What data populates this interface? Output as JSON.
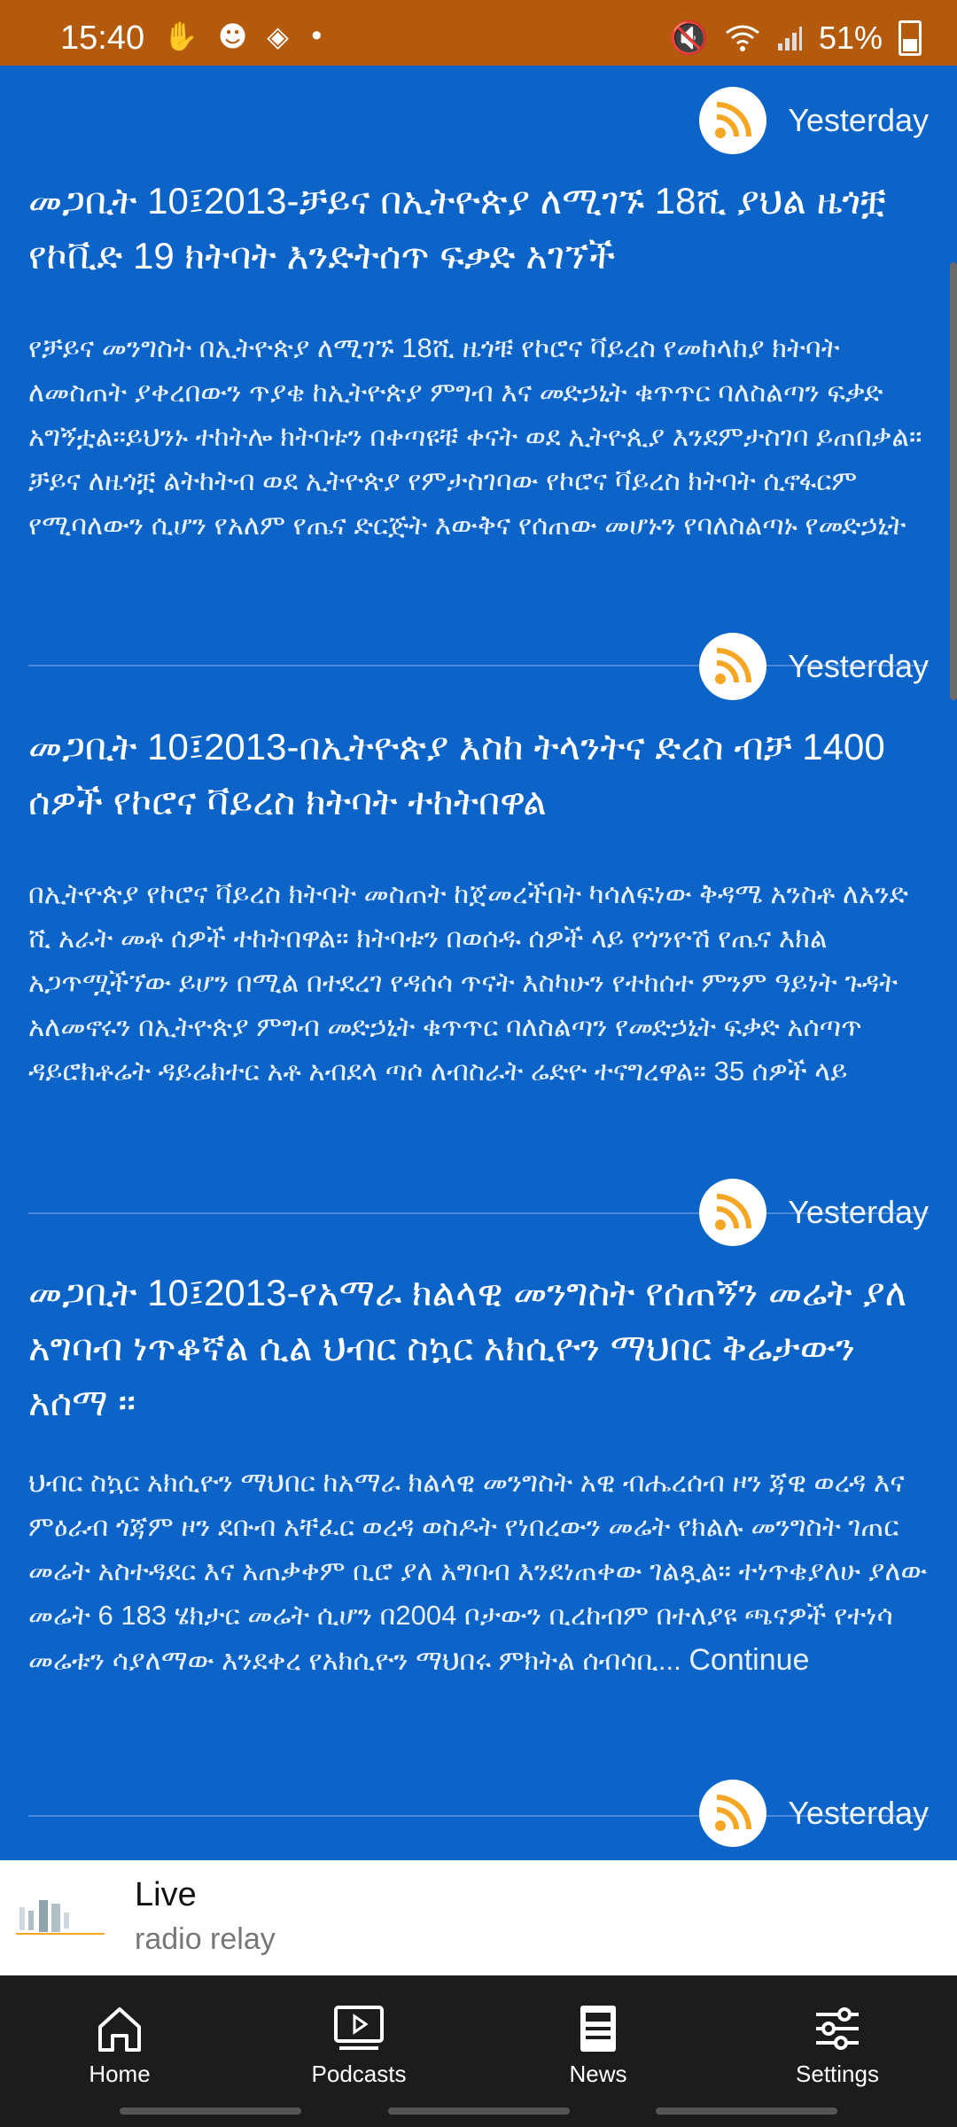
{
  "status": {
    "time": "15:40",
    "battery": "51%",
    "icons": [
      "hand-icon",
      "emoji-icon",
      "stack-icon",
      "dot-icon",
      "mute-icon",
      "wifi-icon",
      "signal-icon",
      "battery-icon"
    ]
  },
  "articles": [
    {
      "date": "Yesterday",
      "title": "መጋቢት 10፤2013-ቻይና በኢትዮጵያ ለሚገኙ 18ሺ ያህል ዜጎቿ የኮቪድ 19 ክትባት  እንድትሰጥ ፍቃድ አገኘች",
      "body": "የቻይና መንግስት በኢትዮጵያ ለሚገኙ 18ሺ ዜጎቹ የኮሮና ቫይረስ የመከላከያ ክትባት ለመስጠት ያቀረበውን ጥያቄ ከኢትዮጵያ ምግብ እና መድኃኒት ቁጥጥር ባለስልጣን ፍቃድ አግኝቷል፡፡ይህንኑ ተከትሎ ክትባቱን በቀጣዩቹ ቀናት ወደ ኢትዮጲያ እንደምታስገባ ይጠበቃል። ቻይና ለዜጎቿ ልትከትብ ወደ ኢትዮጵያ የምታስገባው የኮሮና ቫይረስ ክትባት ሲኖፋርም የሚባለውን ሲሆን የአለም የጤና ድርጅት እውቅና የሰጠው መሆኑን የባለስልጣኑ የመድኃኒት"
    },
    {
      "date": "Yesterday",
      "title": "መጋቢት 10፤2013-በኢትዮጵያ እስከ ትላንትና ድረስ ብቻ 1400 ሰዎች የኮሮና ቫይረስ ክትባት ተከትበዋል",
      "body": "በኢትዮጵያ የኮሮና ቫይረስ ክትባት መስጠት ከጀመረችበት ካሳለፍነው ቅዳሜ አንስቶ ለአንድ ሺ አራት መቶ ሰዎች ተከትበዋል። ክትባቱን በወሰዱ ሰዎች ላይ የጎንዮሽ የጤና እክል አጋጥሟችኘው ይሆን በሚል በተደረገ የዳሰሳ ጥናት እስካሁን የተከሰተ ምንም ዓይነት ጉዳት አለመኖሩን በኢትዮጵያ ምግብ መድኃኒት ቁጥጥር ባለስልጣን የመድኃኒት ፍቃድ አሰጣጥ ዳይሮክቶሬት ዳይሬክተር አቶ አብደላ ጣሶ ለብስራት ሬድዮ ተናግረዋል። 35 ሰዎች ላይ"
    },
    {
      "date": "Yesterday",
      "title": "መጋቢት 10፤2013-የአማራ ክልላዊ መንግስት የሰጠኝን መሬት ያለ አግባብ ነጥቆኛል ሲል ህብር ስኳር አክሲዮን ማህበር ቅሬታውን አሰማ ፡፡",
      "body": "ህብር ስኳር አክሲዮን ማህበር ከአማራ ክልላዊ መንግስት አዊ ብሔረሰብ ዞን ጃዊ ወረዳ እና ምዕራብ ጎጃም ዞን ደቡብ አቸፈር ወረዳ ወስዶት የነበረውን መሬት የክልሉ መንግስት ገጠር መሬት አስተዳደር እና አጠቃቀም ቢሮ ያለ አግባብ እንደነጠቀው ገልጿል። ተነጥቄያለሁ ያለው መሬት 6 183 ሄክታር መሬት ሲሆን በ2004 ቦታውን ቢረከብም በተለያዩ ጫናዎች የተነሳ መሬቱን ሳያለማው እንደቀረ የአክሲዮን ማህበሩ ምክትል ሰብሳቢ...",
      "continue": "Continue"
    },
    {
      "date": "Yesterday"
    }
  ],
  "player": {
    "title": "Live",
    "subtitle": "radio relay"
  },
  "nav": {
    "home": "Home",
    "podcasts": "Podcasts",
    "news": "News",
    "settings": "Settings"
  },
  "colors": {
    "status_bar": "#b35a0c",
    "background": "#0d64c8",
    "rss_orange": "#f5a623",
    "nav_bg": "#1c1c1c"
  }
}
